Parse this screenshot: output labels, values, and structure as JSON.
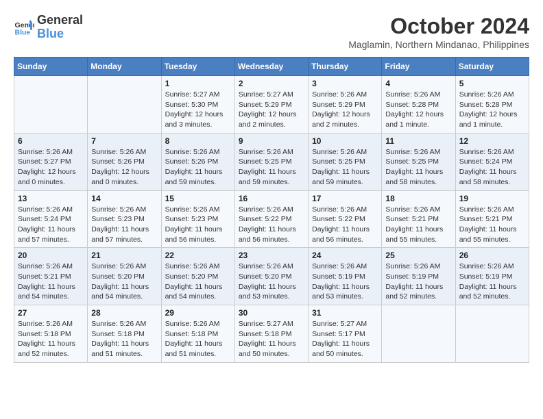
{
  "header": {
    "logo_line1": "General",
    "logo_line2": "Blue",
    "month_year": "October 2024",
    "location": "Maglamin, Northern Mindanao, Philippines"
  },
  "columns": [
    "Sunday",
    "Monday",
    "Tuesday",
    "Wednesday",
    "Thursday",
    "Friday",
    "Saturday"
  ],
  "weeks": [
    [
      {
        "day": "",
        "info": ""
      },
      {
        "day": "",
        "info": ""
      },
      {
        "day": "1",
        "info": "Sunrise: 5:27 AM\nSunset: 5:30 PM\nDaylight: 12 hours and 3 minutes."
      },
      {
        "day": "2",
        "info": "Sunrise: 5:27 AM\nSunset: 5:29 PM\nDaylight: 12 hours and 2 minutes."
      },
      {
        "day": "3",
        "info": "Sunrise: 5:26 AM\nSunset: 5:29 PM\nDaylight: 12 hours and 2 minutes."
      },
      {
        "day": "4",
        "info": "Sunrise: 5:26 AM\nSunset: 5:28 PM\nDaylight: 12 hours and 1 minute."
      },
      {
        "day": "5",
        "info": "Sunrise: 5:26 AM\nSunset: 5:28 PM\nDaylight: 12 hours and 1 minute."
      }
    ],
    [
      {
        "day": "6",
        "info": "Sunrise: 5:26 AM\nSunset: 5:27 PM\nDaylight: 12 hours and 0 minutes."
      },
      {
        "day": "7",
        "info": "Sunrise: 5:26 AM\nSunset: 5:26 PM\nDaylight: 12 hours and 0 minutes."
      },
      {
        "day": "8",
        "info": "Sunrise: 5:26 AM\nSunset: 5:26 PM\nDaylight: 11 hours and 59 minutes."
      },
      {
        "day": "9",
        "info": "Sunrise: 5:26 AM\nSunset: 5:25 PM\nDaylight: 11 hours and 59 minutes."
      },
      {
        "day": "10",
        "info": "Sunrise: 5:26 AM\nSunset: 5:25 PM\nDaylight: 11 hours and 59 minutes."
      },
      {
        "day": "11",
        "info": "Sunrise: 5:26 AM\nSunset: 5:25 PM\nDaylight: 11 hours and 58 minutes."
      },
      {
        "day": "12",
        "info": "Sunrise: 5:26 AM\nSunset: 5:24 PM\nDaylight: 11 hours and 58 minutes."
      }
    ],
    [
      {
        "day": "13",
        "info": "Sunrise: 5:26 AM\nSunset: 5:24 PM\nDaylight: 11 hours and 57 minutes."
      },
      {
        "day": "14",
        "info": "Sunrise: 5:26 AM\nSunset: 5:23 PM\nDaylight: 11 hours and 57 minutes."
      },
      {
        "day": "15",
        "info": "Sunrise: 5:26 AM\nSunset: 5:23 PM\nDaylight: 11 hours and 56 minutes."
      },
      {
        "day": "16",
        "info": "Sunrise: 5:26 AM\nSunset: 5:22 PM\nDaylight: 11 hours and 56 minutes."
      },
      {
        "day": "17",
        "info": "Sunrise: 5:26 AM\nSunset: 5:22 PM\nDaylight: 11 hours and 56 minutes."
      },
      {
        "day": "18",
        "info": "Sunrise: 5:26 AM\nSunset: 5:21 PM\nDaylight: 11 hours and 55 minutes."
      },
      {
        "day": "19",
        "info": "Sunrise: 5:26 AM\nSunset: 5:21 PM\nDaylight: 11 hours and 55 minutes."
      }
    ],
    [
      {
        "day": "20",
        "info": "Sunrise: 5:26 AM\nSunset: 5:21 PM\nDaylight: 11 hours and 54 minutes."
      },
      {
        "day": "21",
        "info": "Sunrise: 5:26 AM\nSunset: 5:20 PM\nDaylight: 11 hours and 54 minutes."
      },
      {
        "day": "22",
        "info": "Sunrise: 5:26 AM\nSunset: 5:20 PM\nDaylight: 11 hours and 54 minutes."
      },
      {
        "day": "23",
        "info": "Sunrise: 5:26 AM\nSunset: 5:20 PM\nDaylight: 11 hours and 53 minutes."
      },
      {
        "day": "24",
        "info": "Sunrise: 5:26 AM\nSunset: 5:19 PM\nDaylight: 11 hours and 53 minutes."
      },
      {
        "day": "25",
        "info": "Sunrise: 5:26 AM\nSunset: 5:19 PM\nDaylight: 11 hours and 52 minutes."
      },
      {
        "day": "26",
        "info": "Sunrise: 5:26 AM\nSunset: 5:19 PM\nDaylight: 11 hours and 52 minutes."
      }
    ],
    [
      {
        "day": "27",
        "info": "Sunrise: 5:26 AM\nSunset: 5:18 PM\nDaylight: 11 hours and 52 minutes."
      },
      {
        "day": "28",
        "info": "Sunrise: 5:26 AM\nSunset: 5:18 PM\nDaylight: 11 hours and 51 minutes."
      },
      {
        "day": "29",
        "info": "Sunrise: 5:26 AM\nSunset: 5:18 PM\nDaylight: 11 hours and 51 minutes."
      },
      {
        "day": "30",
        "info": "Sunrise: 5:27 AM\nSunset: 5:18 PM\nDaylight: 11 hours and 50 minutes."
      },
      {
        "day": "31",
        "info": "Sunrise: 5:27 AM\nSunset: 5:17 PM\nDaylight: 11 hours and 50 minutes."
      },
      {
        "day": "",
        "info": ""
      },
      {
        "day": "",
        "info": ""
      }
    ]
  ]
}
